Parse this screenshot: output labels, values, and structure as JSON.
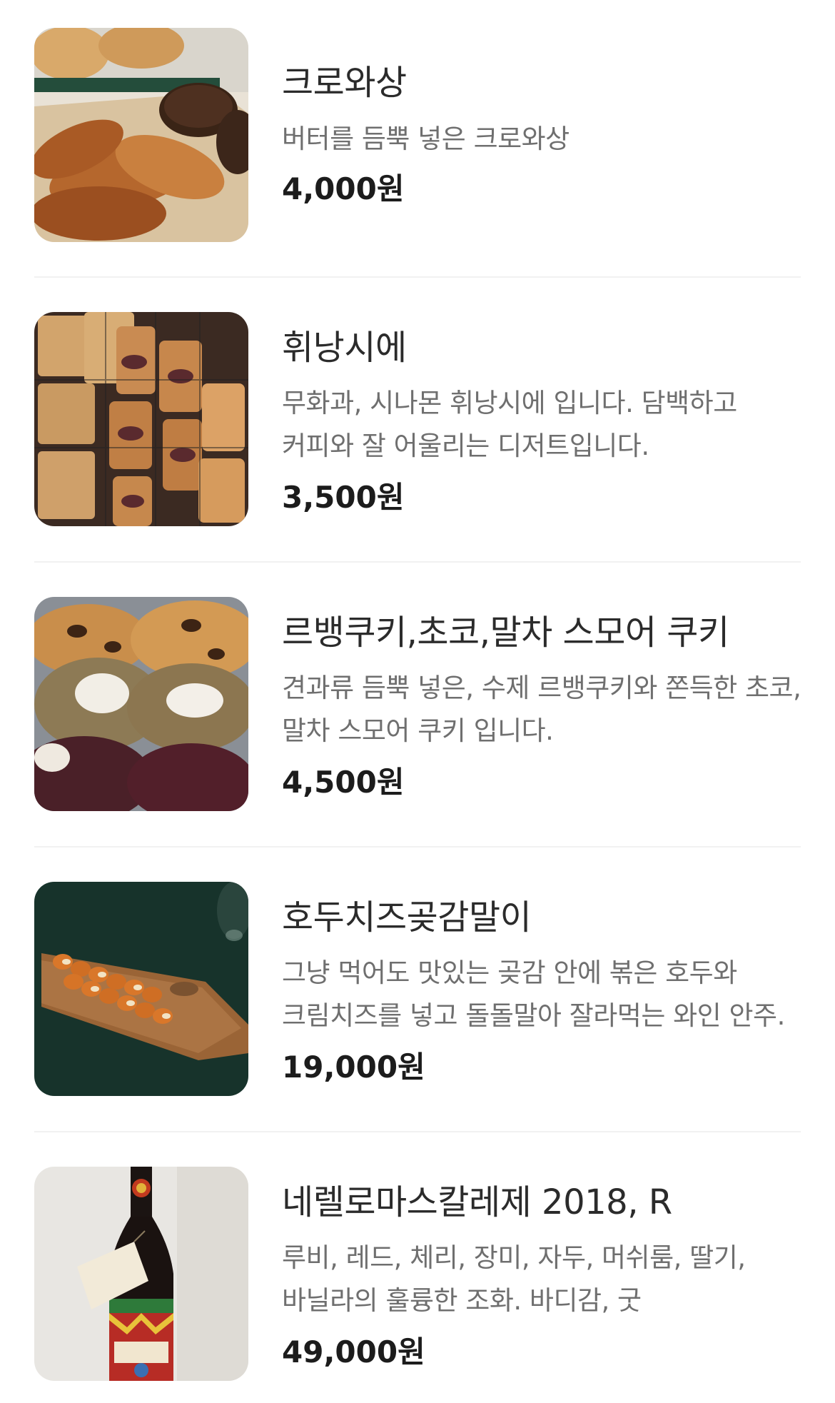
{
  "menu": {
    "items": [
      {
        "name": "크로와상",
        "description": "버터를 듬뿍 넣은 크로와상",
        "price": "4,000원",
        "image": "croissant-photo"
      },
      {
        "name": "휘낭시에",
        "description": "무화과, 시나몬 휘낭시에 입니다. 담백하고 커피와 잘 어울리는 디저트입니다.",
        "price": "3,500원",
        "image": "financier-photo"
      },
      {
        "name": "르뱅쿠키,초코,말차 스모어 쿠키",
        "description": "견과류 듬뿍 넣은, 수제 르뱅쿠키와 쫀득한 초코, 말차 스모어 쿠키 입니다.",
        "price": "4,500원",
        "image": "cookies-photo"
      },
      {
        "name": "호두치즈곶감말이",
        "description": "그냥 먹어도 맛있는 곶감 안에 볶은 호두와 크림치즈를 넣고 돌돌말아 잘라먹는 와인 안주.",
        "price": "19,000원",
        "image": "persimmon-roll-photo"
      },
      {
        "name": "네렐로마스칼레제 2018, R",
        "description": "루비, 레드, 체리, 장미, 자두, 머쉬룸, 딸기, 바닐라의 훌륭한 조화. 바디감, 굿",
        "price": "49,000원",
        "image": "wine-bottle-photo"
      }
    ]
  }
}
